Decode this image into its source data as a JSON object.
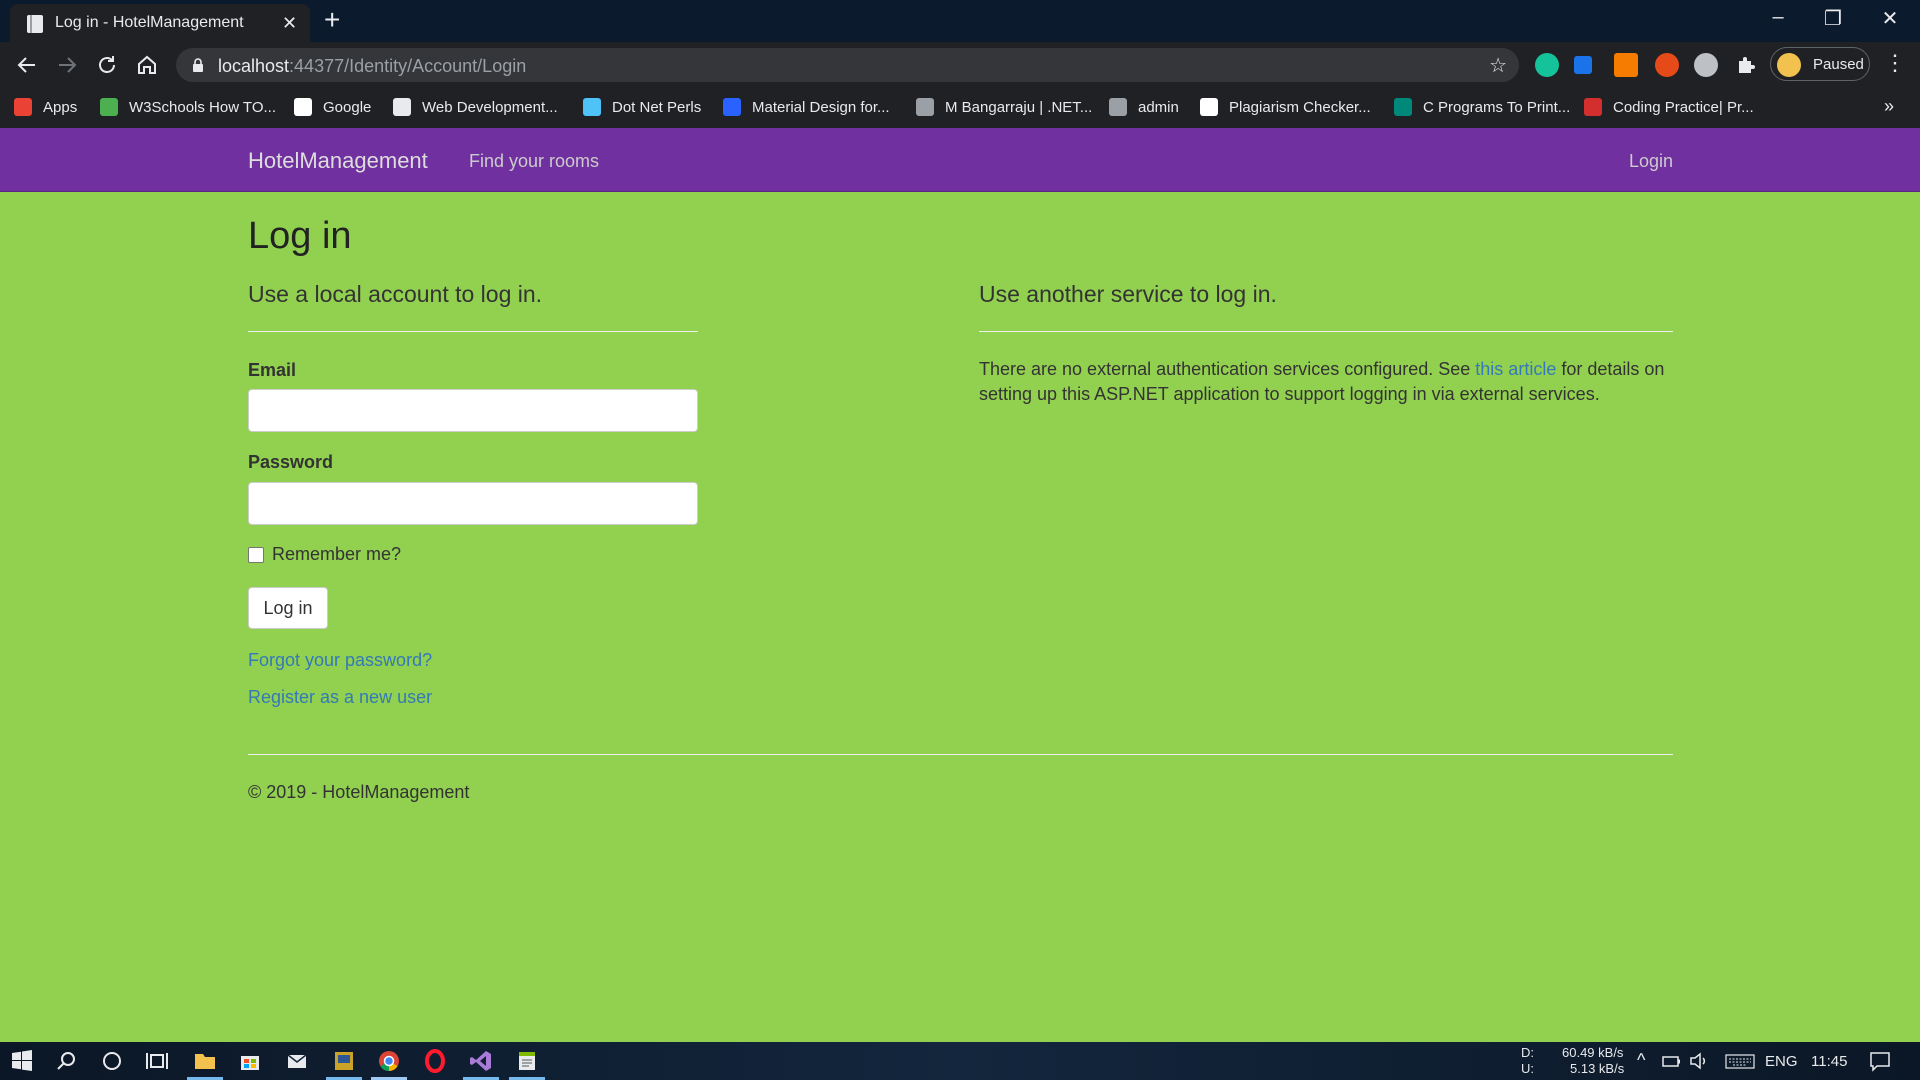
{
  "browser": {
    "tab_title": "Log in - HotelManagement",
    "url_host": "localhost",
    "url_rest": ":44377/Identity/Account/Login",
    "profile_status": "Paused",
    "bookmarks": [
      {
        "label": "Apps",
        "icon": "apps-grid-icon",
        "color": "#ea4335"
      },
      {
        "label": "W3Schools How TO...",
        "icon": "w3schools-icon",
        "color": "#4caf50"
      },
      {
        "label": "Google",
        "icon": "google-icon",
        "color": "#ffffff"
      },
      {
        "label": "Web Development...",
        "icon": "web-dev-icon",
        "color": "#e8eaed"
      },
      {
        "label": "Dot Net Perls",
        "icon": "dotnetperls-icon",
        "color": "#4fc3f7"
      },
      {
        "label": "Material Design for...",
        "icon": "mdb-icon",
        "color": "#2962ff"
      },
      {
        "label": "M Bangarraju | .NET...",
        "icon": "globe-icon",
        "color": "#9aa0a6"
      },
      {
        "label": "admin",
        "icon": "globe-icon",
        "color": "#9aa0a6"
      },
      {
        "label": "Plagiarism Checker...",
        "icon": "sst-icon",
        "color": "#ffffff"
      },
      {
        "label": "C Programs To Print...",
        "icon": "c-programs-icon",
        "color": "#00897b"
      },
      {
        "label": "Coding Practice| Pr...",
        "icon": "coding-practice-icon",
        "color": "#d32f2f"
      }
    ]
  },
  "navbar": {
    "brand": "HotelManagement",
    "find_rooms": "Find your rooms",
    "login": "Login"
  },
  "login": {
    "title": "Log in",
    "local_heading": "Use a local account to log in.",
    "email_label": "Email",
    "email_value": "",
    "password_label": "Password",
    "password_value": "",
    "remember_label": "Remember me?",
    "remember_checked": false,
    "submit_label": "Log in",
    "forgot_link": "Forgot your password?",
    "register_link": "Register as a new user"
  },
  "external": {
    "heading": "Use another service to log in.",
    "text_before": "There are no external authentication services configured. See ",
    "link_text": "this article",
    "text_after": " for details on setting up this ASP.NET application to support logging in via external services."
  },
  "footer": {
    "text": "© 2019 - HotelManagement"
  },
  "taskbar": {
    "net_down_label": "D:",
    "net_down": "60.49 kB/s",
    "net_up_label": "U:",
    "net_up": "5.13 kB/s",
    "language": "ENG",
    "time": "11:45"
  },
  "colors": {
    "page_background": "#92d050",
    "navbar_background": "#7030a0",
    "link": "#337ab7"
  }
}
